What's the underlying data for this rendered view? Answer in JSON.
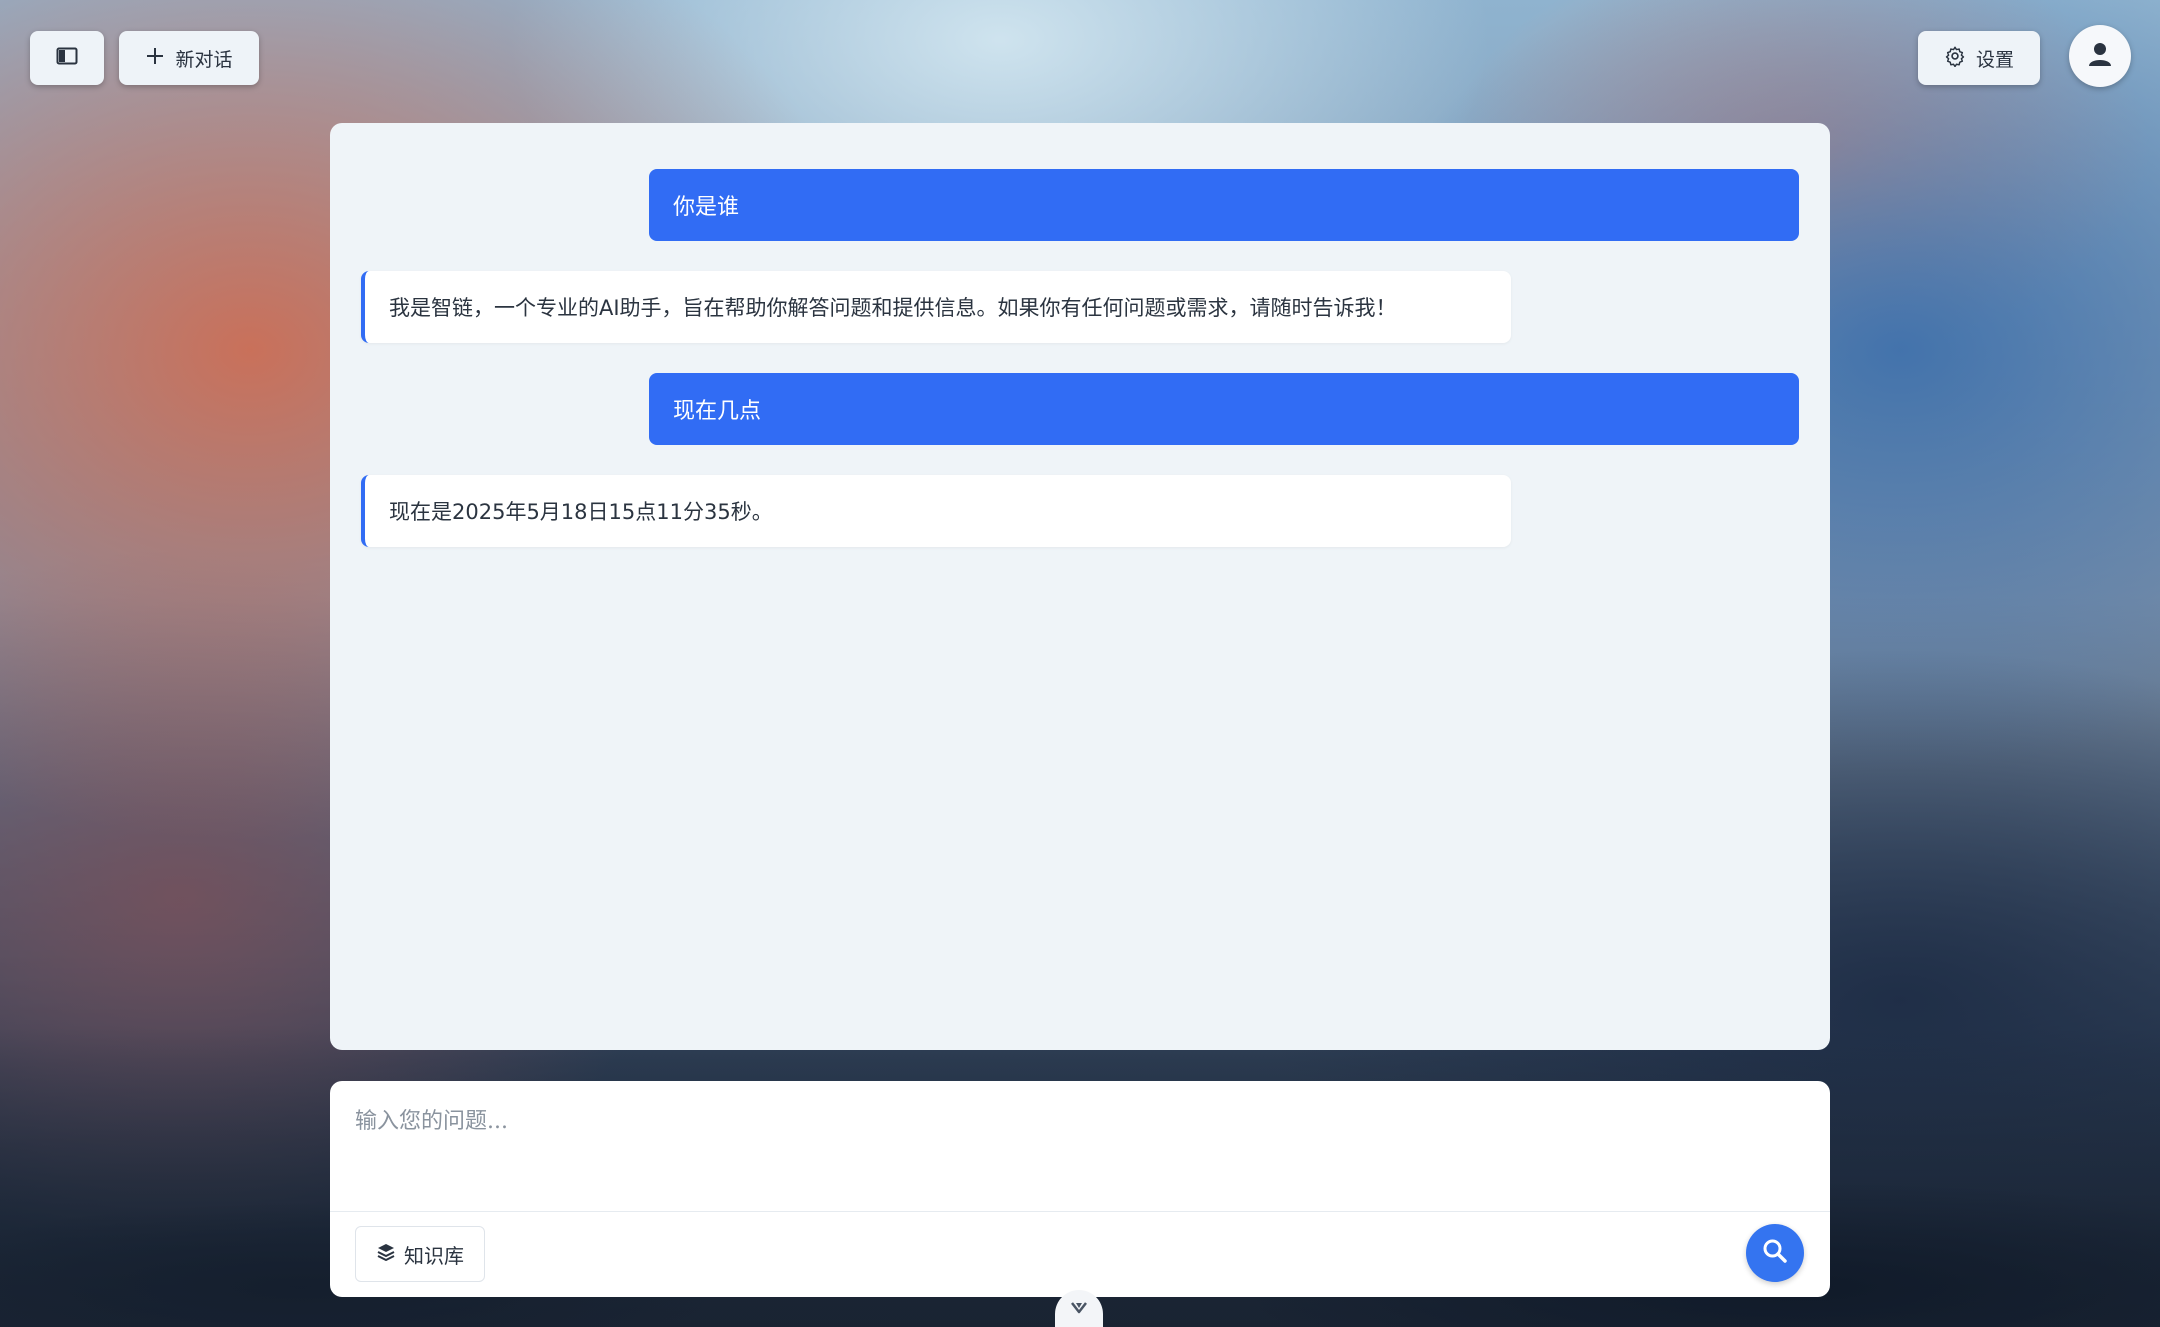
{
  "header": {
    "new_chat_label": "新对话",
    "settings_label": "设置"
  },
  "messages": [
    {
      "role": "user",
      "text": "你是谁"
    },
    {
      "role": "assistant",
      "text": "我是智链，一个专业的AI助手，旨在帮助你解答问题和提供信息。如果你有任何问题或需求，请随时告诉我！"
    },
    {
      "role": "user",
      "text": "现在几点"
    },
    {
      "role": "assistant",
      "text": "现在是2025年5月18日15点11分35秒。"
    }
  ],
  "input": {
    "placeholder": "输入您的问题...",
    "value": ""
  },
  "toolbar": {
    "knowledge_base_label": "知识库"
  },
  "icons": {
    "sidebar_toggle": "sidebar-icon",
    "new_chat": "plus-icon",
    "settings": "gear-icon",
    "avatar": "user-icon",
    "knowledge_base": "layers-icon",
    "send": "search-icon",
    "scroll_down": "chevron-down-icon"
  },
  "colors": {
    "accent": "#316cf4",
    "panel_bg": "#eff4f8"
  }
}
